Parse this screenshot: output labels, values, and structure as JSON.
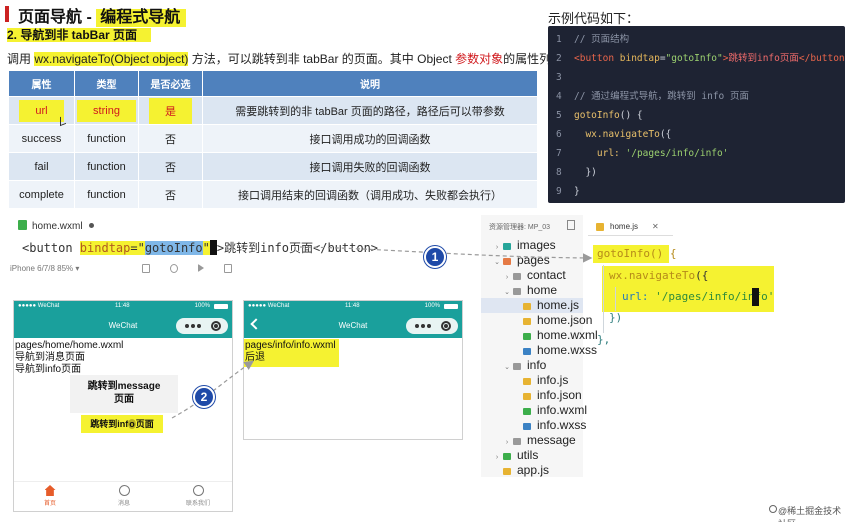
{
  "title": {
    "prefix": "页面导航 - ",
    "highlight": "编程式导航"
  },
  "subtitle": "2. 导航到非 tabBar 页面",
  "description": {
    "before": "调用 ",
    "api": "wx.navigateTo(Object object)",
    "middle": " 方法，可以跳转到非 tabBar 的页面。其中 Object ",
    "red": "参数对象",
    "after": "的属性列表"
  },
  "props_table": {
    "headers": [
      "属性",
      "类型",
      "是否必选",
      "说明"
    ],
    "rows": [
      [
        "url",
        "string",
        "是",
        "需要跳转到的非 tabBar 页面的路径，路径后可以带参数"
      ],
      [
        "success",
        "function",
        "否",
        "接口调用成功的回调函数"
      ],
      [
        "fail",
        "function",
        "否",
        "接口调用失败的回调函数"
      ],
      [
        "complete",
        "function",
        "否",
        "接口调用结束的回调函数（调用成功、失败都会执行）"
      ]
    ]
  },
  "example": {
    "title": "示例代码如下：",
    "lines": [
      {
        "n": "1",
        "comment": "// 页面结构"
      },
      {
        "n": "2",
        "tag_open": "<button ",
        "attr": "bindtap",
        "eq": "=",
        "str": "\"gotoInfo\"",
        "close": ">",
        "text": "跳转到info页面",
        "tag_close": "</button>"
      },
      {
        "n": "3"
      },
      {
        "n": "4",
        "comment": "// 通过编程式导航，跳转到 info 页面"
      },
      {
        "n": "5",
        "fn": "gotoInfo",
        "rest": "() {"
      },
      {
        "n": "6",
        "indent": "  ",
        "fn": "wx.navigateTo",
        "rest": "({"
      },
      {
        "n": "7",
        "indent": "    ",
        "key": "url: ",
        "str": "'/pages/info/info'"
      },
      {
        "n": "8",
        "rest": "  })"
      },
      {
        "n": "9",
        "rest": "}"
      }
    ]
  },
  "editor": {
    "tab": "home.wxml",
    "line": {
      "tag_open": "<button ",
      "attr": "bindtap",
      "eq": "=\"",
      "sel": "gotoInfo",
      "q": "\"",
      "close": ">",
      "text": "跳转到info页面",
      "tag_close": "</button>"
    }
  },
  "toolbar": {
    "device": "iPhone 6/7/8 85% ▾"
  },
  "phone_home": {
    "status_left": "●●●●● WeChat",
    "time": "11:48",
    "battery": "100%",
    "nav_title": "WeChat",
    "path": "pages/home/home.wxml",
    "line1": "导航到消息页面",
    "line2": "导航到info页面",
    "msg_btn": "跳转到message\n页面",
    "info_btn_before": "跳转到inf",
    "info_btn_o": "o",
    "info_btn_after": "页面",
    "tabs": [
      "首页",
      "消息",
      "联系我们"
    ]
  },
  "phone_info": {
    "status_left": "●●●●● WeChat",
    "time": "11:48",
    "battery": "100%",
    "nav_title": "WeChat",
    "path": "pages/info/info.wxml",
    "line1": "后退"
  },
  "explorer": {
    "header": "资源管理器: MP_03",
    "items": [
      {
        "chev": "›",
        "name": "images",
        "color": "#26a69a",
        "depth": 0
      },
      {
        "chev": "⌄",
        "name": "pages",
        "color": "#e57a45",
        "depth": 0
      },
      {
        "chev": "›",
        "name": "contact",
        "color": "#999999",
        "depth": 1
      },
      {
        "chev": "⌄",
        "name": "home",
        "color": "#999999",
        "depth": 1
      },
      {
        "chev": "",
        "name": "home.js",
        "color": "#e7b332",
        "depth": 2,
        "active": true
      },
      {
        "chev": "",
        "name": "home.json",
        "color": "#e7b332",
        "depth": 2
      },
      {
        "chev": "",
        "name": "home.wxml",
        "color": "#3cae4b",
        "depth": 2
      },
      {
        "chev": "",
        "name": "home.wxss",
        "color": "#3b82c4",
        "depth": 2
      },
      {
        "chev": "⌄",
        "name": "info",
        "color": "#999999",
        "depth": 1
      },
      {
        "chev": "",
        "name": "info.js",
        "color": "#e7b332",
        "depth": 2
      },
      {
        "chev": "",
        "name": "info.json",
        "color": "#e7b332",
        "depth": 2
      },
      {
        "chev": "",
        "name": "info.wxml",
        "color": "#3cae4b",
        "depth": 2
      },
      {
        "chev": "",
        "name": "info.wxss",
        "color": "#3b82c4",
        "depth": 2
      },
      {
        "chev": "›",
        "name": "message",
        "color": "#999999",
        "depth": 1
      },
      {
        "chev": "›",
        "name": "utils",
        "color": "#3cae4b",
        "depth": 0
      },
      {
        "chev": "",
        "name": "app.js",
        "color": "#e7b332",
        "depth": 0
      }
    ]
  },
  "right_editor": {
    "tab": "home.js",
    "close": "✕",
    "line1": "gotoInfo() {",
    "line2_fn": "wx.navigateTo",
    "line2_rest": "({",
    "line3_key": "url: ",
    "line3_str": "'/pages/info/info'",
    "line4": "})",
    "line5": "},"
  },
  "badges": {
    "one": "1",
    "two": "2"
  },
  "watermark": "@稀土掘金技术社区",
  "colors": {
    "highlight": "#f5f231",
    "table_header": "#4f81bd",
    "teal": "#1aa09c",
    "badge": "#1f4aa8",
    "code_bg": "#1e2333"
  }
}
